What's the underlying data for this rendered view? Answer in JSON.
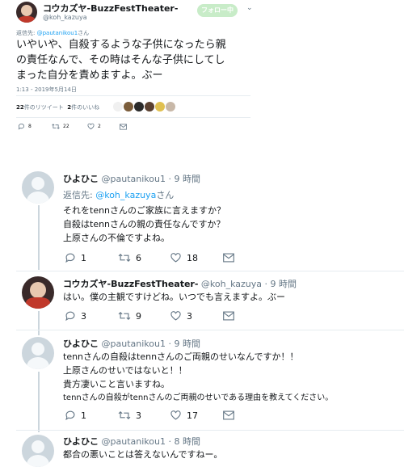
{
  "main_tweet": {
    "display_name": "コウカズヤ-BuzzFestTheater-",
    "handle": "@koh_kazuya",
    "follow_label": "フォロー中",
    "reply_to_prefix": "返信先:",
    "reply_to_handle": "@pautanikou1",
    "reply_to_suffix": "さん",
    "lines": [
      "いやいや、自殺するような子供になったら親",
      "の責任なんで、その時はそんな子供にしてし",
      "まった自分を責めますよ。ぶー"
    ],
    "timestamp": "1:13 - 2019年5月14日",
    "retweets_count": "22",
    "retweets_label": "件のリツイート",
    "likes_count": "2",
    "likes_label": "件のいいね",
    "reply_count": "8",
    "rt_count": "22",
    "like_count": "2"
  },
  "replies": [
    {
      "name": "ひよひこ",
      "handle": "@pautanikou1",
      "time": "· 9 時間",
      "reply_prefix": "返信先:",
      "reply_handle": "@koh_kazuya",
      "reply_suffix": "さん",
      "lines": [
        "それをtennさんのご家族に言えますか？",
        "自殺はtennさんの親の責任なんですか？",
        "上原さんの不倫ですよね。"
      ],
      "reply_count": "1",
      "rt_count": "6",
      "like_count": "18"
    },
    {
      "name": "コウカズヤ-BuzzFestTheater-",
      "handle": "@koh_kazuya",
      "time": "· 9 時間",
      "lines": [
        "はい。僕の主観ですけどね。いつでも言えますよ。ぶー"
      ],
      "reply_count": "3",
      "rt_count": "9",
      "like_count": "3"
    },
    {
      "name": "ひよひこ",
      "handle": "@pautanikou1",
      "time": "· 9 時間",
      "lines": [
        "tennさんの自殺はtennさんのご両親のせいなんですか！！",
        "上原さんのせいではないと！！",
        "貴方凄いこと言いますね。",
        "tennさんの自殺がtennさんのご両親のせいである理由を教えてください。"
      ],
      "reply_count": "1",
      "rt_count": "3",
      "like_count": "17"
    },
    {
      "name": "ひよひこ",
      "handle": "@pautanikou1",
      "time": "· 8 時間",
      "lines": [
        "都合の悪いことは答えないんですねー。"
      ]
    }
  ],
  "colors": {
    "follow_bg": "#c8ecc8",
    "link": "#1da1f2",
    "thread_line": "#ccd6dd",
    "muted": "#657786"
  }
}
